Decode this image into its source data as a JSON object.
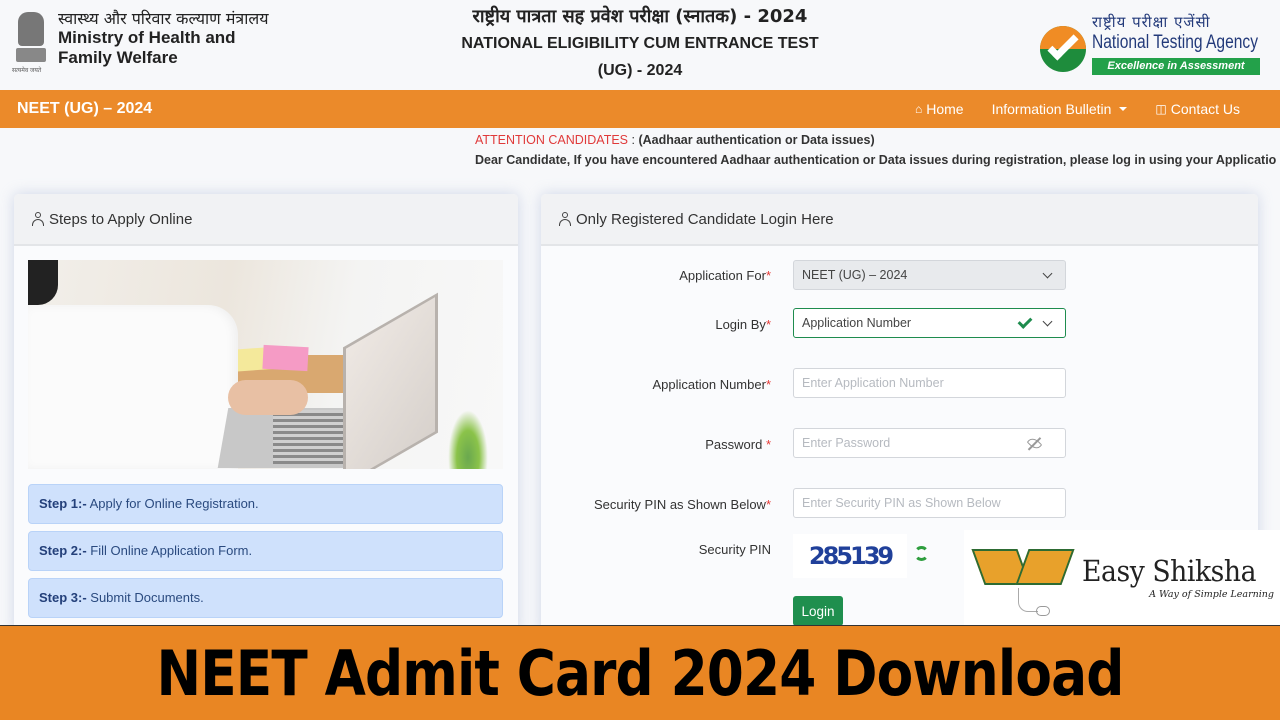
{
  "header": {
    "ministry": {
      "hindi": "स्वास्थ्य और परिवार कल्याण मंत्रालय",
      "line1": "Ministry of Health and",
      "line2": "Family Welfare",
      "motto": "सत्यमेव जयते"
    },
    "title": {
      "hindi": "राष्ट्रीय पात्रता सह प्रवेश परीक्षा (स्नातक) - 2024",
      "line1": "NATIONAL ELIGIBILITY CUM ENTRANCE TEST",
      "line2": "(UG) - 2024"
    },
    "agency": {
      "hindi": "राष्ट्रीय परीक्षा एजेंसी",
      "name": "National Testing Agency",
      "tagline": "Excellence in Assessment"
    }
  },
  "navbar": {
    "brand": "NEET (UG) – 2024",
    "items": [
      {
        "label": "Home",
        "icon": "home-icon"
      },
      {
        "label": "Information Bulletin",
        "icon": "caret-down-icon"
      },
      {
        "label": "Contact Us",
        "icon": "chat-icon"
      }
    ],
    "bg_color": "#eb8a2a"
  },
  "notice": {
    "attention": "ATTENTION CANDIDATES",
    "separator": " : ",
    "subject": "(Aadhaar authentication or Data issues)",
    "message": "Dear Candidate, If you have encountered Aadhaar authentication or Data issues during registration, please log in using your Applicatio"
  },
  "steps_card": {
    "title": "Steps to Apply Online",
    "steps": [
      {
        "label": "Step 1:-",
        "text": " Apply for Online Registration."
      },
      {
        "label": "Step 2:-",
        "text": " Fill Online Application Form."
      },
      {
        "label": "Step 3:-",
        "text": " Submit Documents."
      }
    ]
  },
  "login_card": {
    "title": "Only Registered Candidate Login Here",
    "fields": {
      "application_for": {
        "label": "Application For",
        "required": "*",
        "value": "NEET (UG) – 2024"
      },
      "login_by": {
        "label": "Login By",
        "required": "*",
        "value": "Application Number"
      },
      "application_number": {
        "label": "Application Number",
        "required": "*",
        "placeholder": "Enter Application Number"
      },
      "password": {
        "label": "Password ",
        "required": "*",
        "placeholder": "Enter Password"
      },
      "security_pin_input": {
        "label": "Security PIN as Shown Below",
        "required": "*",
        "placeholder": "Enter Security PIN as Shown Below"
      },
      "security_pin": {
        "label": "Security PIN",
        "captcha": "285139"
      }
    },
    "login_button": "Login"
  },
  "watermark": {
    "name": "Easy Shiksha",
    "tagline": "A Way of Simple Learning"
  },
  "banner": {
    "text": "NEET Admit Card 2024 Download",
    "bg_color": "#e98623"
  }
}
